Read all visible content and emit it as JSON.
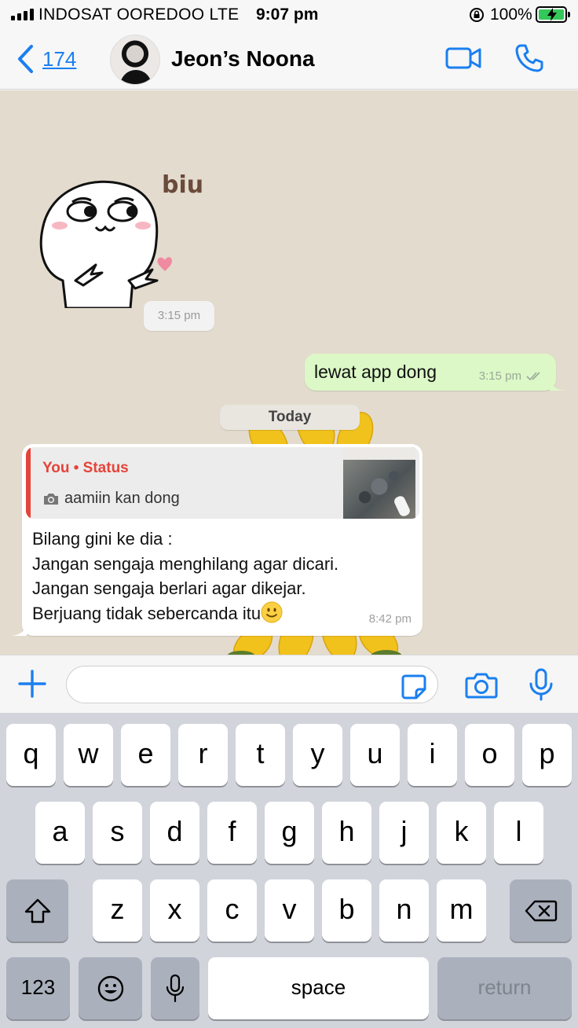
{
  "status_bar": {
    "carrier": "INDOSAT OOREDOO  LTE",
    "time": "9:07 pm",
    "battery": "100%",
    "battery_level": 1.0
  },
  "header": {
    "back_count": "174",
    "contact_name": "Jeon’s Noona"
  },
  "chat": {
    "messages": [
      {
        "type": "sticker",
        "direction": "incoming",
        "sticker_text": "biu",
        "time": "3:15 pm"
      },
      {
        "type": "text",
        "direction": "outgoing",
        "text": "lewat app dong",
        "time": "3:15 pm",
        "read_status": "double-tick"
      },
      {
        "type": "date-separator",
        "text": "Today"
      },
      {
        "type": "reply",
        "direction": "incoming",
        "quote": {
          "author": "You • Status",
          "text": "aamiin kan dong",
          "icon": "camera-icon"
        },
        "lines": [
          "Bilang gini ke dia :",
          "Jangan sengaja menghilang agar dicari.",
          "Jangan sengaja berlari agar dikejar.",
          "Berjuang tidak sebercanda itu"
        ],
        "emoji": "slightly-smiling-face",
        "time": "8:42 pm"
      }
    ]
  },
  "input_bar": {
    "placeholder": "",
    "value": ""
  },
  "keyboard": {
    "row1": [
      "q",
      "w",
      "e",
      "r",
      "t",
      "y",
      "u",
      "i",
      "o",
      "p"
    ],
    "row2": [
      "a",
      "s",
      "d",
      "f",
      "g",
      "h",
      "j",
      "k",
      "l"
    ],
    "row3": [
      "z",
      "x",
      "c",
      "v",
      "b",
      "n",
      "m"
    ],
    "number_key": "123",
    "space_key": "space",
    "return_key": "return"
  },
  "colors": {
    "accent": "#1a7ff0",
    "outgoing_bubble": "#dcf8c6",
    "quote_author": "#e5443a",
    "chat_background": "#e3dbcd"
  }
}
